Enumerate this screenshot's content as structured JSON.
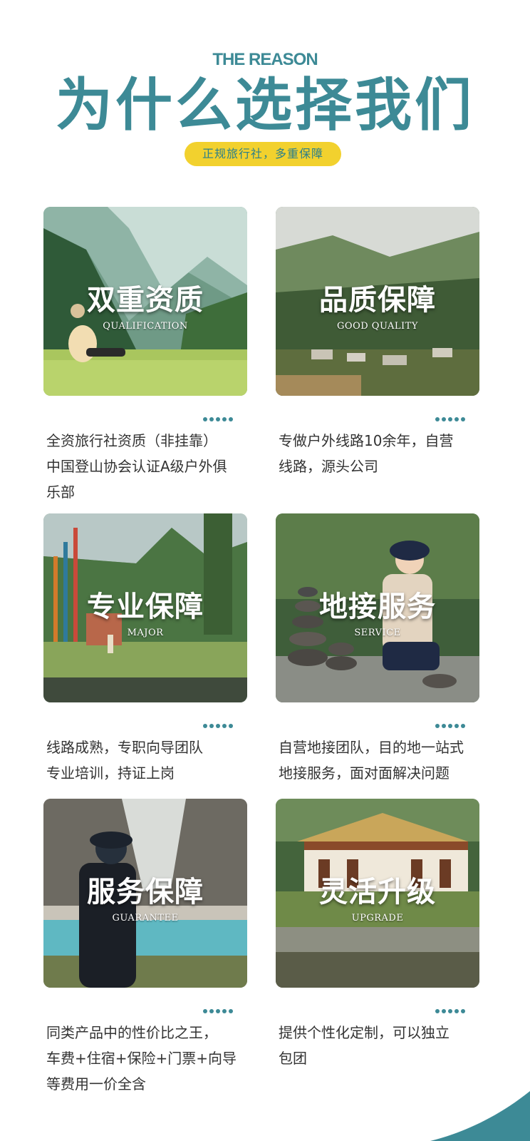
{
  "header": {
    "reason_label": "THE REASON",
    "title": "为什么选择我们",
    "tagline": "正规旅行社，多重保障"
  },
  "colors": {
    "accent": "#3d8a96",
    "pill": "#f2d12e",
    "text": "#333333"
  },
  "cards": [
    {
      "title": "双重资质",
      "subtitle": "QUALIFICATION",
      "lines": [
        "全资旅行社资质（非挂靠）",
        "中国登山协会认证A级户外俱",
        "乐部"
      ]
    },
    {
      "title": "品质保障",
      "subtitle": "GOOD QUALITY",
      "lines": [
        "专做户外线路10余年，自营",
        "线路，源头公司"
      ]
    },
    {
      "title": "专业保障",
      "subtitle": "MAJOR",
      "lines": [
        "线路成熟，专职向导团队",
        "专业培训，持证上岗"
      ]
    },
    {
      "title": "地接服务",
      "subtitle": "SERVICE",
      "lines": [
        "自营地接团队，目的地一站式",
        "地接服务，面对面解决问题"
      ]
    },
    {
      "title": "服务保障",
      "subtitle": "GUARANTEE",
      "lines": [
        "同类产品中的性价比之王，",
        "车费+住宿+保险+门票+向导",
        "等费用一价全含"
      ]
    },
    {
      "title": "灵活升级",
      "subtitle": "UPGRADE",
      "lines": [
        "提供个性化定制，可以独立",
        "包团"
      ]
    }
  ]
}
